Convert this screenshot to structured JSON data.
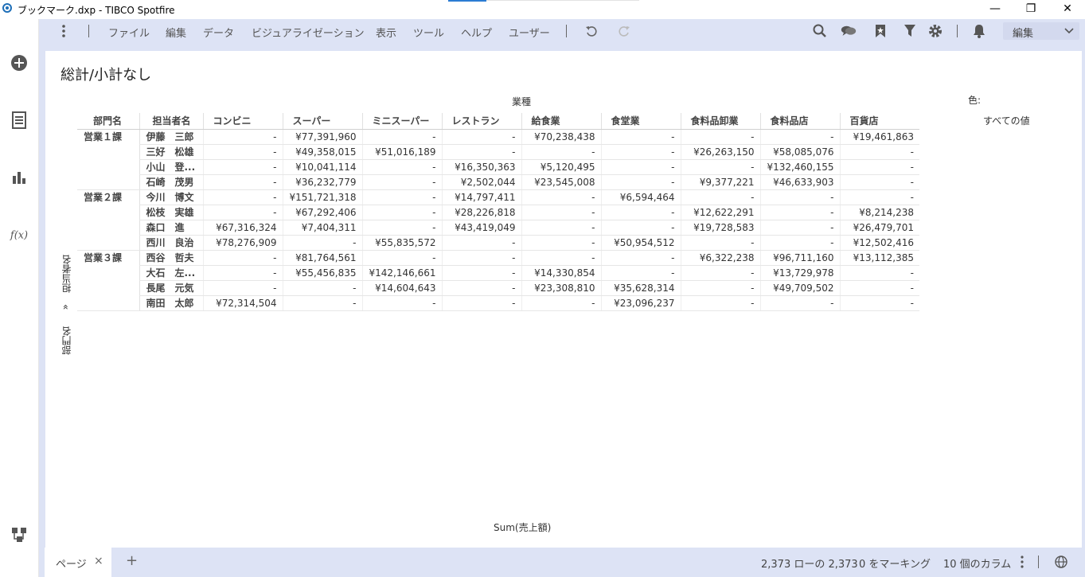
{
  "window": {
    "title": "ブックマーク.dxp - TIBCO Spotfire",
    "minimize": "—",
    "restore": "❐",
    "close": "✕"
  },
  "menu": {
    "items": [
      "ファイル",
      "編集",
      "データ",
      "ビジュアライゼーション",
      "表示",
      "ツール",
      "ヘルプ",
      "ユーザー"
    ],
    "mode_select": "編集"
  },
  "viz": {
    "title": "総計/小計なし",
    "column_axis_title": "業種",
    "row_header_1": "部門名",
    "row_header_2": "担当者名",
    "columns": [
      "コンビニ",
      "スーパー",
      "ミニスーパー",
      "レストラン",
      "給食業",
      "食堂業",
      "食料品卸業",
      "食料品店",
      "百貨店"
    ],
    "rows": [
      {
        "dept": "営業１課",
        "person": "伊藤　三郎",
        "values": [
          "-",
          "¥77,391,960",
          "-",
          "-",
          "¥70,238,438",
          "-",
          "-",
          "-",
          "¥19,461,863"
        ]
      },
      {
        "dept": "",
        "person": "三好　松雄",
        "values": [
          "-",
          "¥49,358,015",
          "¥51,016,189",
          "-",
          "-",
          "-",
          "¥26,263,150",
          "¥58,085,076",
          "-"
        ]
      },
      {
        "dept": "",
        "person": "小山　登...",
        "values": [
          "-",
          "¥10,041,114",
          "-",
          "¥16,350,363",
          "¥5,120,495",
          "-",
          "-",
          "¥132,460,155",
          "-"
        ]
      },
      {
        "dept": "",
        "person": "石崎　茂男",
        "values": [
          "-",
          "¥36,232,779",
          "-",
          "¥2,502,044",
          "¥23,545,008",
          "-",
          "¥9,377,221",
          "¥46,633,903",
          "-"
        ]
      },
      {
        "dept": "営業２課",
        "person": "今川　博文",
        "values": [
          "-",
          "¥151,721,318",
          "-",
          "¥14,797,411",
          "-",
          "¥6,594,464",
          "-",
          "-",
          "-"
        ]
      },
      {
        "dept": "",
        "person": "松枝　実雄",
        "values": [
          "-",
          "¥67,292,406",
          "-",
          "¥28,226,818",
          "-",
          "-",
          "¥12,622,291",
          "-",
          "¥8,214,238"
        ]
      },
      {
        "dept": "",
        "person": "森口　進",
        "values": [
          "¥67,316,324",
          "¥7,404,311",
          "-",
          "¥43,419,049",
          "-",
          "-",
          "¥19,728,583",
          "-",
          "¥26,479,701"
        ]
      },
      {
        "dept": "",
        "person": "西川　良治",
        "values": [
          "¥78,276,909",
          "-",
          "¥55,835,572",
          "-",
          "-",
          "¥50,954,512",
          "-",
          "-",
          "¥12,502,416"
        ]
      },
      {
        "dept": "営業３課",
        "person": "西谷　哲夫",
        "values": [
          "-",
          "¥81,764,561",
          "-",
          "-",
          "-",
          "-",
          "¥6,322,238",
          "¥96,711,160",
          "¥13,112,385"
        ]
      },
      {
        "dept": "",
        "person": "大石　左...",
        "values": [
          "-",
          "¥55,456,835",
          "¥142,146,661",
          "-",
          "¥14,330,854",
          "-",
          "-",
          "¥13,729,978",
          "-"
        ]
      },
      {
        "dept": "",
        "person": "長尾　元気",
        "values": [
          "-",
          "-",
          "¥14,604,643",
          "-",
          "¥23,308,810",
          "¥35,628,314",
          "-",
          "¥49,709,502",
          "-"
        ]
      },
      {
        "dept": "",
        "person": "南田　太郎",
        "values": [
          "¥72,314,504",
          "-",
          "-",
          "-",
          "-",
          "¥23,096,237",
          "-",
          "-",
          "-"
        ]
      }
    ],
    "dept_groups": [
      {
        "label": "営業１課",
        "rowspan": 4
      },
      {
        "label": "営業２課",
        "rowspan": 4
      },
      {
        "label": "営業３課",
        "rowspan": 4
      }
    ],
    "legend_title": "色:",
    "legend_item": "すべての値",
    "value_axis": "Sum(売上額)",
    "row_axis_vertical_1": "担当者名",
    "row_axis_vertical_sep": "»",
    "row_axis_vertical_2": "部門名"
  },
  "bottom": {
    "page_tab": "ページ",
    "page_tab_close": "×",
    "add_page": "+",
    "row_count": "2,373 ローの 2,373",
    "marking": "0 をマーキング",
    "columns": "10 個のカラム"
  }
}
